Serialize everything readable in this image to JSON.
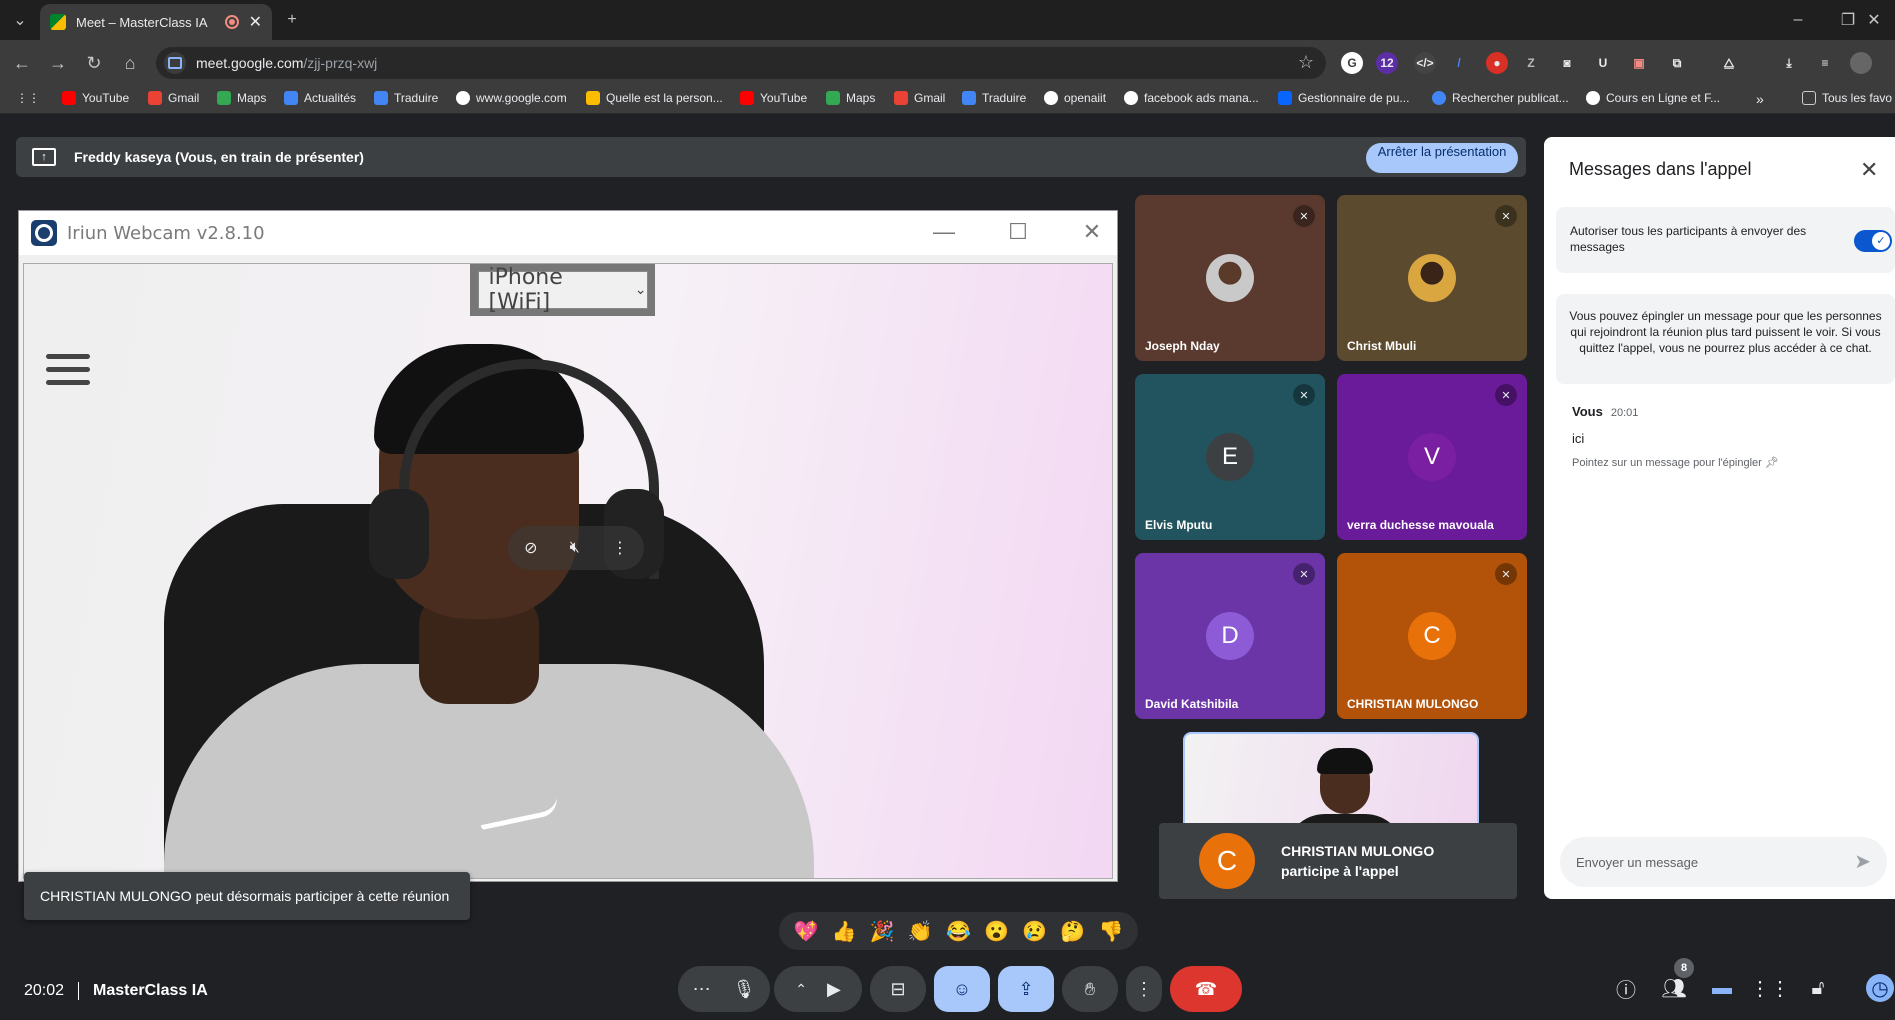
{
  "browser": {
    "tab_title": "Meet – MasterClass IA",
    "url_host": "meet.google.com",
    "url_path": "/zjj-przq-xwj",
    "extension_badge": "12",
    "bookmarks": [
      {
        "label": "YouTube",
        "icon": "youtube-icon",
        "color": "#ff0000"
      },
      {
        "label": "Gmail",
        "icon": "gmail-icon",
        "color": "#ea4335"
      },
      {
        "label": "Maps",
        "icon": "maps-icon",
        "color": "#34a853"
      },
      {
        "label": "Actualités",
        "icon": "news-icon",
        "color": "#4285f4"
      },
      {
        "label": "Traduire",
        "icon": "translate-icon",
        "color": "#4285f4"
      },
      {
        "label": "www.google.com",
        "icon": "google-icon",
        "color": "#ffffff"
      },
      {
        "label": "Quelle est la person...",
        "icon": "site-icon",
        "color": "#fbbc04"
      },
      {
        "label": "YouTube",
        "icon": "youtube-icon",
        "color": "#ff0000"
      },
      {
        "label": "Maps",
        "icon": "maps-icon",
        "color": "#34a853"
      },
      {
        "label": "Gmail",
        "icon": "gmail-icon",
        "color": "#ea4335"
      },
      {
        "label": "Traduire",
        "icon": "translate-icon",
        "color": "#4285f4"
      },
      {
        "label": "openaiit",
        "icon": "openai-icon",
        "color": "#ffffff"
      },
      {
        "label": "facebook ads mana...",
        "icon": "google-icon",
        "color": "#ffffff"
      },
      {
        "label": "Gestionnaire de pu...",
        "icon": "meta-icon",
        "color": "#0866ff"
      },
      {
        "label": "Rechercher publicat...",
        "icon": "site-icon",
        "color": "#4285f4"
      },
      {
        "label": "Cours en Ligne et F...",
        "icon": "google-icon",
        "color": "#ffffff"
      }
    ],
    "more_bookmarks": "»",
    "all_bookmarks": "Tous les favo"
  },
  "meet": {
    "presenting_text": "Freddy kaseya (Vous, en train de présenter)",
    "stop_presenting": "Arrêter la présentation",
    "iriun_title": "Iriun Webcam v2.8.10",
    "device_select": "iPhone [WiFi]",
    "participants": [
      {
        "name": "Joseph Nday",
        "initial": "",
        "bg": "#5a3a2e",
        "avatar_color": ""
      },
      {
        "name": "Christ Mbuli",
        "initial": "",
        "bg": "#5c4a2e",
        "avatar_color": ""
      },
      {
        "name": "Elvis Mputu",
        "initial": "E",
        "bg": "#21545e",
        "avatar_color": "#3c4043"
      },
      {
        "name": "verra duchesse mavouala",
        "initial": "V",
        "bg": "#6a1b9a",
        "avatar_color": "#7b1fa2"
      },
      {
        "name": "David Katshibila",
        "initial": "D",
        "bg": "#6b35a8",
        "avatar_color": "#8e5bd6"
      },
      {
        "name": "CHRISTIAN MULONGO",
        "initial": "C",
        "bg": "#b35309",
        "avatar_color": "#e8710a"
      }
    ],
    "join_toast": {
      "initial": "C",
      "line1": "CHRISTIAN MULONGO",
      "line2": "participe à l'appel"
    },
    "notification": "CHRISTIAN MULONGO peut désormais participer à cette réunion",
    "reactions": [
      "💖",
      "👍",
      "🎉",
      "👏",
      "😂",
      "😮",
      "😢",
      "🤔",
      "👎"
    ],
    "time": "20:02",
    "meeting_name": "MasterClass IA",
    "people_count": "8"
  },
  "chat": {
    "title": "Messages dans l'appel",
    "allow_text": "Autoriser tous les participants à envoyer des messages",
    "pin_info": "Vous pouvez épingler un message pour que les personnes qui rejoindront la réunion plus tard puissent le voir. Si vous quittez l'appel, vous ne pourrez plus accéder à ce chat.",
    "message": {
      "sender": "Vous",
      "time": "20:01",
      "body": "ici",
      "hint": "Pointez sur un message pour l'épingler"
    },
    "input_placeholder": "Envoyer un message"
  }
}
